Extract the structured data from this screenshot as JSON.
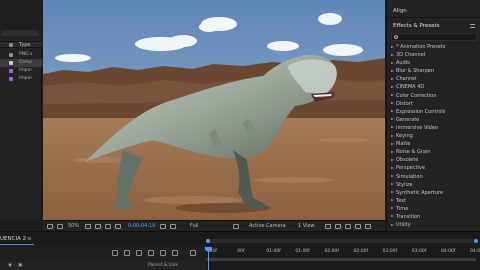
{
  "project_panel": {
    "column_type": "Type",
    "rows": [
      {
        "type": "PNG s",
        "color": "#8c8c8c",
        "selected": false
      },
      {
        "type": "Comp",
        "color": "#c8c8c8",
        "selected": true
      },
      {
        "type": "Impor",
        "color": "#9a6ad6",
        "selected": false
      },
      {
        "type": "Impor",
        "color": "#9a6ad6",
        "selected": false
      }
    ]
  },
  "viewer_bar": {
    "zoom": "50%",
    "timecode": "0:00:04:19",
    "resolution": "Full",
    "camera": "Active Camera",
    "view": "1 View"
  },
  "right_panel": {
    "align_title": "Align",
    "effects_title": "Effects & Presets",
    "search_placeholder": "",
    "effects": [
      "* Animation Presets",
      "3D Channel",
      "Audio",
      "Blur & Sharpen",
      "Channel",
      "CINEMA 4D",
      "Color Correction",
      "Distort",
      "Expression Controls",
      "Generate",
      "Immersive Video",
      "Keying",
      "Matte",
      "Noise & Grain",
      "Obsolete",
      "Perspective",
      "Simulation",
      "Stylize",
      "Synthetic Aperture",
      "Text",
      "Time",
      "Transition",
      "Utility"
    ]
  },
  "timeline": {
    "tab_label": "UENCIA 2",
    "tab_close": "≡",
    "col_parent": "Parent & Link",
    "ruler_ticks": [
      ":00f",
      "00f",
      "01:00f",
      "01:00f",
      "02:00f",
      "02:00f",
      "03:00f",
      "03:00f",
      "04:00f",
      "04:00f"
    ]
  },
  "colors": {
    "accent": "#4d9bff",
    "panel_bg": "#232323",
    "sky": "#6f8fb6",
    "ground": "#9c7252"
  }
}
